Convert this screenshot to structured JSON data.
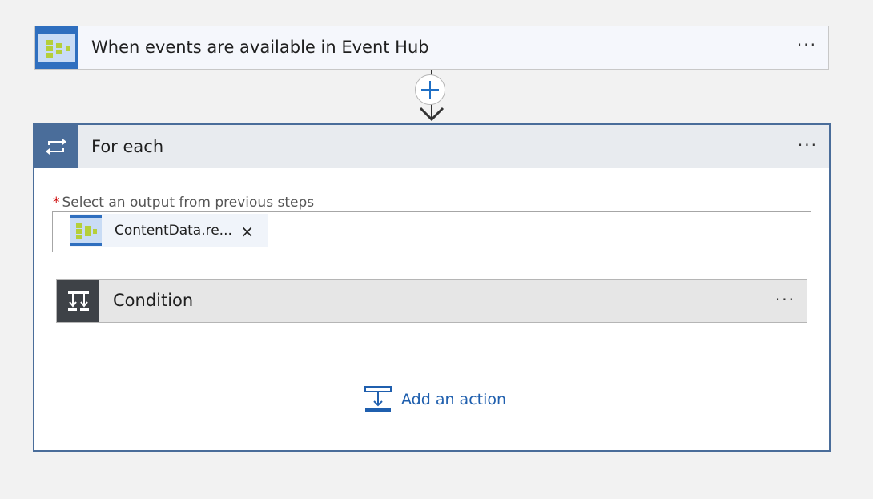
{
  "trigger": {
    "title": "When events are available in Event Hub",
    "icon": "event-hub-icon",
    "menu": "···"
  },
  "connector": {
    "add_icon": "plus-icon",
    "arrow_icon": "arrow-down-icon"
  },
  "foreach": {
    "title": "For each",
    "icon": "loop-icon",
    "menu": "···",
    "output_label": "Select an output from previous steps",
    "required_mark": "*",
    "token": {
      "label": "ContentData.re...",
      "icon": "event-hub-icon",
      "remove": "×"
    }
  },
  "condition": {
    "title": "Condition",
    "icon": "condition-icon",
    "menu": "···"
  },
  "add_action": {
    "label": "Add an action",
    "icon": "add-action-icon"
  },
  "colors": {
    "accent": "#2f6fbf",
    "foreach_border": "#4a6d9a",
    "link": "#1f5fae",
    "condition_icon_bg": "#3e4247",
    "eventhub_green": "#b5cf3a"
  }
}
